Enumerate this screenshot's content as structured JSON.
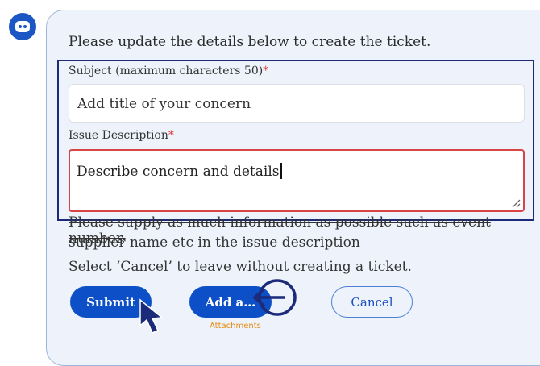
{
  "form": {
    "intro": "Please update the details below to create the ticket.",
    "subject_label": "Subject (maximum characters 50)",
    "subject_value": "Add title of your concern",
    "description_label": "Issue Description",
    "description_value": "Describe concern and details",
    "required_marker": "*",
    "hint_line1": "Please supply as much information as possible such as event number,",
    "hint_line2": "supplier name etc in the issue description",
    "cancel_hint": "Select ‘Cancel’ to leave without creating a ticket."
  },
  "buttons": {
    "submit": "Submit",
    "add": "Add a…",
    "cancel": "Cancel",
    "attachments_tooltip": "Attachments"
  },
  "colors": {
    "primary": "#0d4fc7",
    "required": "#d93b3b",
    "error_border": "#d94444",
    "annotation": "#1c2a7a",
    "tooltip": "#e58a10"
  },
  "icons": {
    "avatar": "chatbot-icon",
    "cursor": "mouse-pointer-icon",
    "annotation": "circled-left-arrow-icon"
  }
}
